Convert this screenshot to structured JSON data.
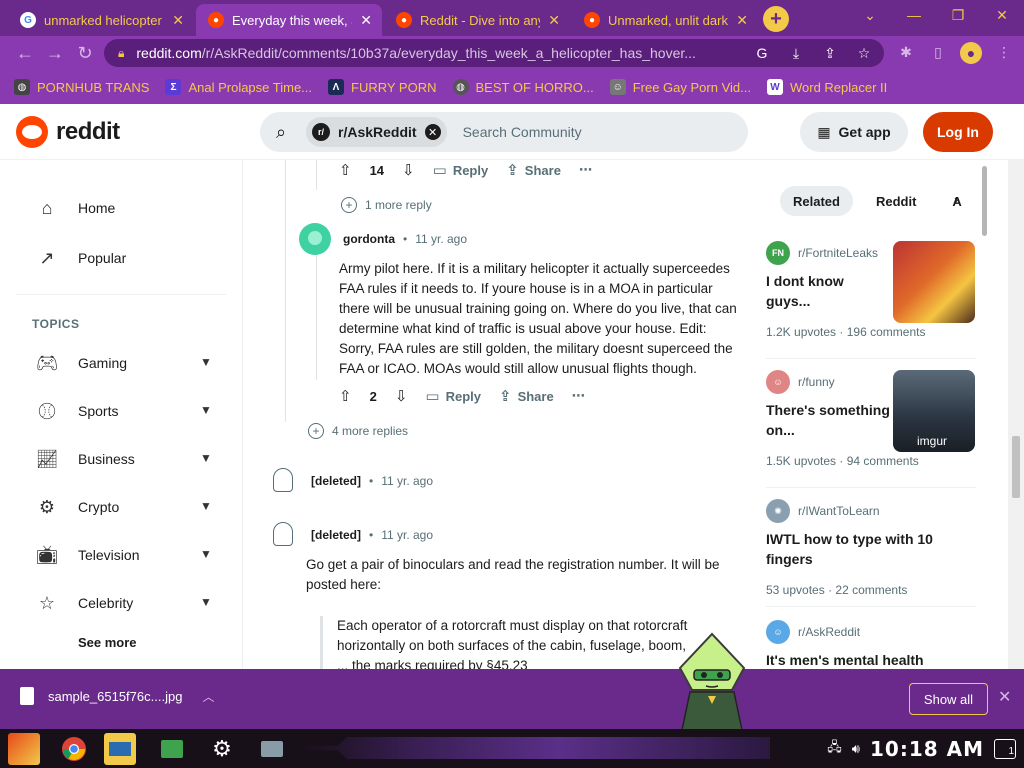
{
  "browser": {
    "tabs": [
      {
        "title": "unmarked helicopter o",
        "favicon": "google-icon",
        "active": false
      },
      {
        "title": "Everyday this week, a",
        "favicon": "reddit-icon",
        "active": true
      },
      {
        "title": "Reddit - Dive into any",
        "favicon": "reddit-icon",
        "active": false
      },
      {
        "title": "Unmarked, unlit dark",
        "favicon": "reddit-icon",
        "active": false
      }
    ],
    "url_host": "reddit.com",
    "url_path": "/r/AskReddit/comments/10b37a/everyday_this_week_a_helicopter_has_hover...",
    "bookmarks": [
      "PORNHUB TRANS",
      "Anal Prolapse Time...",
      "FURRY PORN",
      "BEST OF HORRO...",
      "Free Gay Porn Vid...",
      "Word Replacer II"
    ],
    "accent": "#8a3ab0",
    "text_accent": "#f3c94a"
  },
  "header": {
    "logo_text": "reddit",
    "community": "r/AskReddit",
    "search_placeholder": "Search Community",
    "get_app": "Get app",
    "login": "Log In"
  },
  "left_nav": {
    "items": [
      {
        "label": "Home",
        "icon": "home-icon"
      },
      {
        "label": "Popular",
        "icon": "popular-icon"
      }
    ],
    "topics_title": "TOPICS",
    "topics": [
      {
        "label": "Gaming",
        "icon": "gamepad-icon"
      },
      {
        "label": "Sports",
        "icon": "baseball-icon"
      },
      {
        "label": "Business",
        "icon": "chart-icon"
      },
      {
        "label": "Crypto",
        "icon": "crypto-icon"
      },
      {
        "label": "Television",
        "icon": "tv-icon"
      },
      {
        "label": "Celebrity",
        "icon": "star-icon"
      }
    ],
    "see_more": "See more"
  },
  "thread": {
    "top_actions": {
      "score": "14",
      "reply": "Reply",
      "share": "Share"
    },
    "more_replies_1": "1 more reply",
    "comment1": {
      "author": "gordonta",
      "age": "11 yr. ago",
      "body": "Army pilot here. If it is a military helicopter it actually superceedes FAA rules if it needs to. If youre house is in a MOA in particular there will be unusual training going on. Where do you live, that can determine what kind of traffic is usual above your house. Edit: Sorry, FAA rules are still golden, the military doesnt superceed the FAA or ICAO. MOAs would still allow unusual flights though.",
      "score": "2",
      "reply": "Reply",
      "share": "Share"
    },
    "more_replies_2": "4 more replies",
    "comment2": {
      "author": "[deleted]",
      "age": "11 yr. ago"
    },
    "comment3": {
      "author": "[deleted]",
      "age": "11 yr. ago",
      "body": "Go get a pair of binoculars and read the registration number. It will be posted here:",
      "quote": "Each operator of a rotorcraft must display on that rotorcraft horizontally on both surfaces of the cabin, fuselage, boom, ... the marks required by §45.23"
    }
  },
  "right_sidebar": {
    "tabs": [
      "Related",
      "Reddit",
      "A"
    ],
    "posts": [
      {
        "sub": "r/FortniteLeaks",
        "title": "I dont know guys...",
        "upvotes": "1.2K upvotes",
        "comments": "196 comments",
        "icon_color": "#3fa34d"
      },
      {
        "sub": "r/funny",
        "title": "There's something on...",
        "upvotes": "1.5K upvotes",
        "comments": "94 comments",
        "thumb_label": "imgur",
        "icon_color": "#e08585"
      },
      {
        "sub": "r/IWantToLearn",
        "title": "IWTL how to type with 10 fingers",
        "upvotes": "53 upvotes",
        "comments": "22 comments",
        "icon_color": "#8aa0b0"
      },
      {
        "sub": "r/AskReddit",
        "title": "It's men's mental health",
        "icon_color": "#5aa9e6"
      }
    ]
  },
  "downloads": {
    "file": "sample_6515f76c....jpg",
    "show_all": "Show all"
  },
  "taskbar": {
    "clock": "10:18 AM",
    "notifications": "1"
  }
}
